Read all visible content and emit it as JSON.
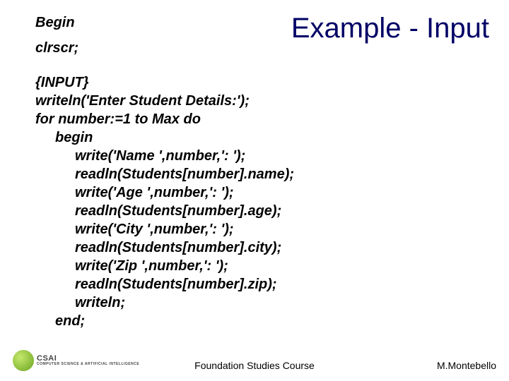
{
  "title": "Example - Input",
  "topLeft": {
    "line1": "Begin",
    "line2": "clrscr;"
  },
  "code": {
    "l01": "{INPUT}",
    "l02": "writeln('Enter Student Details:');",
    "l03": "for number:=1 to Max do",
    "l04": "begin",
    "l05": "write('Name ',number,': ');",
    "l06": "readln(Students[number].name);",
    "l07": "write('Age ',number,': ');",
    "l08": "readln(Students[number].age);",
    "l09": "write('City ',number,': ');",
    "l10": "readln(Students[number].city);",
    "l11": "write('Zip ',number,': ');",
    "l12": "readln(Students[number].zip);",
    "l13": "writeln;",
    "l14": "end;"
  },
  "footer": {
    "center": "Foundation Studies Course",
    "right": "M.Montebello"
  },
  "logo": {
    "name": "CSAI",
    "sub": "COMPUTER SCIENCE & ARTIFICIAL INTELLIGENCE"
  }
}
